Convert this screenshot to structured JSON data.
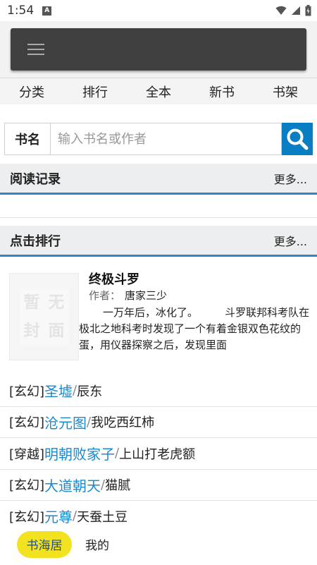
{
  "status_bar": {
    "time": "1:54",
    "notif_badge": "A"
  },
  "app_bar": {
    "menu_icon": "hamburger-menu-icon"
  },
  "tabs": [
    {
      "label": "分类"
    },
    {
      "label": "排行"
    },
    {
      "label": "全本"
    },
    {
      "label": "新书"
    },
    {
      "label": "书架"
    }
  ],
  "search": {
    "label": "书名",
    "placeholder": "输入书名或作者",
    "icon": "search-icon"
  },
  "reading_history": {
    "title": "阅读记录",
    "more": "更多..."
  },
  "click_ranking": {
    "title": "点击排行",
    "more": "更多..."
  },
  "featured_book": {
    "cover_text": [
      "暂",
      "无",
      "封",
      "面"
    ],
    "title": "终极斗罗",
    "author_label": "作者：",
    "author": "唐家三少",
    "description": "一万年后，冰化了。        斗罗联邦科考队在极北之地科考时发现了一个有着金银双色花纹的蛋，用仪器探察之后，发现里面"
  },
  "ranking_list": [
    {
      "category": "[玄幻]",
      "title": "圣墟",
      "sep": "/",
      "author": "辰东"
    },
    {
      "category": "[玄幻]",
      "title": "沧元图",
      "sep": "/",
      "author": "我吃西红柿"
    },
    {
      "category": "[穿越]",
      "title": "明朝败家子",
      "sep": "/",
      "author": "上山打老虎额"
    },
    {
      "category": "[玄幻]",
      "title": "大道朝天",
      "sep": "/",
      "author": "猫腻"
    },
    {
      "category": "[玄幻]",
      "title": "元尊",
      "sep": "/",
      "author": "天蚕土豆"
    }
  ],
  "bottom_nav": {
    "home": "书海居",
    "mine": "我的"
  },
  "colors": {
    "accent": "#0a7ec2",
    "section_border": "#2c86c5",
    "link": "#1a8ad0",
    "nav_pill": "#f3e21f",
    "app_bar": "#404040"
  }
}
